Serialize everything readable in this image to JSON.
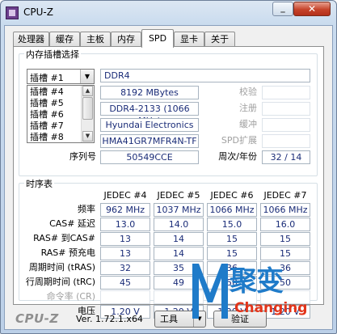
{
  "window": {
    "title": "CPU-Z"
  },
  "tabs": [
    "处理器",
    "缓存",
    "主板",
    "内存",
    "SPD",
    "显卡",
    "关于"
  ],
  "slot_group": {
    "title": "内存插槽选择",
    "selected_slot": "插槽 #1",
    "slot_list": [
      "插槽 #4",
      "插槽 #5",
      "插槽 #6",
      "插槽 #7",
      "插槽 #8"
    ],
    "memory_type": "DDR4",
    "module_size": "8192 MBytes",
    "max_bandwidth": "DDR4-2133 (1066 MHz)",
    "manufacturer": "Hyundai Electronics",
    "part_number": "HMA41GR7MFR4N-TF",
    "serial_label": "序列号",
    "serial_number": "50549CCE",
    "right_labels": {
      "correction": "校验",
      "registered": "注册",
      "buffered": "缓冲",
      "spd_ext": "SPD扩展",
      "week_year": "周次/年份"
    },
    "week_year": "32 / 14"
  },
  "timings": {
    "title": "时序表",
    "columns": [
      "JEDEC #4",
      "JEDEC #5",
      "JEDEC #6",
      "JEDEC #7"
    ],
    "rows": [
      {
        "label": "频率",
        "values": [
          "962 MHz",
          "1037 MHz",
          "1066 MHz",
          "1066 MHz"
        ],
        "grayed": false
      },
      {
        "label": "CAS# 延迟",
        "values": [
          "13.0",
          "14.0",
          "15.0",
          "16.0"
        ],
        "grayed": false
      },
      {
        "label": "RAS# 到CAS#",
        "values": [
          "13",
          "14",
          "15",
          "15"
        ],
        "grayed": false
      },
      {
        "label": "RAS# 预充电",
        "values": [
          "13",
          "14",
          "15",
          "15"
        ],
        "grayed": false
      },
      {
        "label": "周期时间 (tRAS)",
        "values": [
          "32",
          "35",
          "36",
          "36"
        ],
        "grayed": false
      },
      {
        "label": "行周期时间 (tRC)",
        "values": [
          "45",
          "49",
          "50",
          "50"
        ],
        "grayed": false
      },
      {
        "label": "命令率 (CR)",
        "values": [
          "",
          "",
          "",
          ""
        ],
        "grayed": true
      },
      {
        "label": "电压",
        "values": [
          "1.20 V",
          "1.20 V",
          "1.20 V",
          "1.20 V"
        ],
        "grayed": false
      }
    ]
  },
  "bottom": {
    "logo": "CPU-Z",
    "version": "Ver. 1.72.1.x64",
    "tools_label": "工具",
    "validate_label": "验证"
  },
  "watermark": {
    "cn": "聚变",
    "en": "Changing"
  },
  "colors": {
    "value_text": "#1a2c78",
    "watermark_blue": "#1f7bc9",
    "watermark_red": "#e2341a"
  }
}
